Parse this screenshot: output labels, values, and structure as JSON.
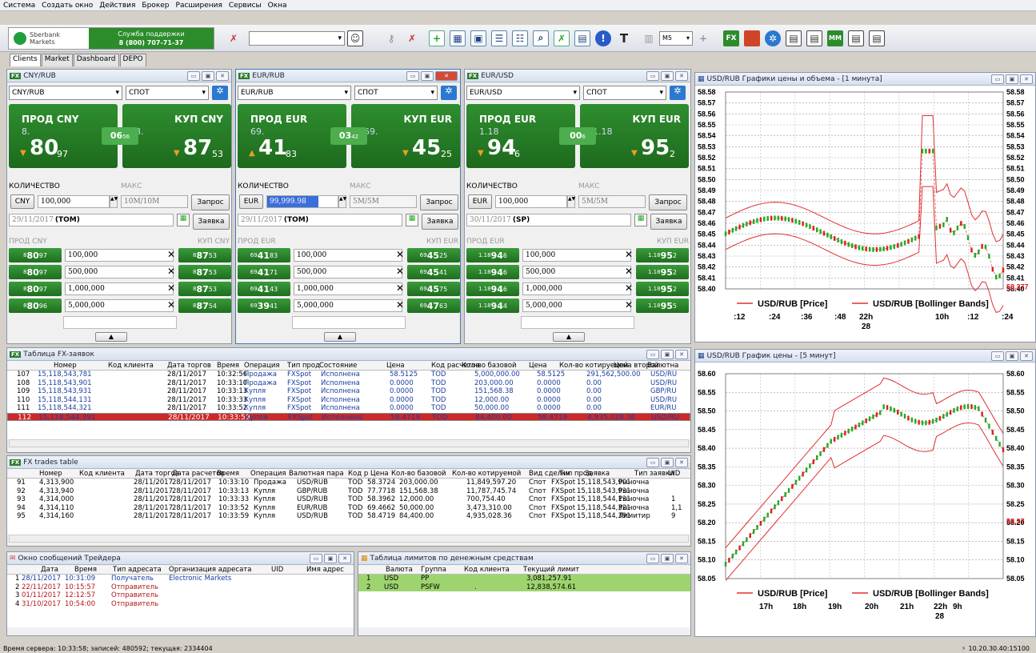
{
  "menu": [
    "Система",
    "Создать окно",
    "Действия",
    "Брокер",
    "Расширения",
    "Сервисы",
    "Окна"
  ],
  "brand": {
    "name": "Sberbank",
    "sub": "Markets",
    "support_title": "Служба поддержки",
    "support_phone": "8 (800) 707-71-37"
  },
  "toolbar": {
    "interval": "M5",
    "fx": "FX",
    "mm": "MM"
  },
  "tabs": [
    "Clients",
    "Market",
    "Dashboard",
    "DEPO"
  ],
  "fx_panels": [
    {
      "title": "CNY/RUB",
      "pair": "CNY/RUB",
      "mode": "СПОТ",
      "sell_label": "ПРОД CNY",
      "buy_label": "КУП CNY",
      "sell_pre": "8.",
      "sell_big": "80",
      "sell_sm": "97",
      "buy_pre": "8.",
      "buy_big": "87",
      "buy_sm": "53",
      "spread_big": "06",
      "spread_sm": "56",
      "qty_label": "КОЛИЧЕСТВО",
      "max_label": "МАКС",
      "ccy": "CNY",
      "qty": "100,000",
      "limit": "10M/10M",
      "request": "Запрос",
      "date": "29/11/2017",
      "date_tag": "(TOM)",
      "order": "Заявка",
      "sell_col": "ПРОД CNY",
      "buy_col": "КУП CNY",
      "ladder": [
        {
          "s_pre": "8",
          "s_big": "80",
          "s_sm": "97",
          "amt": "100,000",
          "b_pre": "8",
          "b_big": "87",
          "b_sm": "53"
        },
        {
          "s_pre": "8",
          "s_big": "80",
          "s_sm": "97",
          "amt": "500,000",
          "b_pre": "8",
          "b_big": "87",
          "b_sm": "53"
        },
        {
          "s_pre": "8",
          "s_big": "80",
          "s_sm": "97",
          "amt": "1,000,000",
          "b_pre": "8",
          "b_big": "87",
          "b_sm": "53"
        },
        {
          "s_pre": "8",
          "s_big": "80",
          "s_sm": "96",
          "amt": "5,000,000",
          "b_pre": "8",
          "b_big": "87",
          "b_sm": "54"
        }
      ]
    },
    {
      "title": "EUR/RUB",
      "pair": "EUR/RUB",
      "mode": "СПОТ",
      "sell_label": "ПРОД EUR",
      "buy_label": "КУП EUR",
      "sell_pre": "69.",
      "sell_big": "41",
      "sell_sm": "83",
      "buy_pre": "69.",
      "buy_big": "45",
      "buy_sm": "25",
      "spread_big": "03",
      "spread_sm": "42",
      "qty_label": "КОЛИЧЕСТВО",
      "max_label": "МАКС",
      "ccy": "EUR",
      "qty": "99,999.98",
      "limit": "5M/5M",
      "request": "Запрос",
      "date": "29/11/2017",
      "date_tag": "(TOM)",
      "order": "Заявка",
      "sell_col": "ПРОД EUR",
      "buy_col": "КУП EUR",
      "ladder": [
        {
          "s_pre": "69",
          "s_big": "41",
          "s_sm": "83",
          "amt": "100,000",
          "b_pre": "69",
          "b_big": "45",
          "b_sm": "25"
        },
        {
          "s_pre": "69",
          "s_big": "41",
          "s_sm": "71",
          "amt": "500,000",
          "b_pre": "69",
          "b_big": "45",
          "b_sm": "41"
        },
        {
          "s_pre": "69",
          "s_big": "41",
          "s_sm": "43",
          "amt": "1,000,000",
          "b_pre": "69",
          "b_big": "45",
          "b_sm": "75"
        },
        {
          "s_pre": "69",
          "s_big": "39",
          "s_sm": "41",
          "amt": "5,000,000",
          "b_pre": "69",
          "b_big": "47",
          "b_sm": "63"
        }
      ]
    },
    {
      "title": "EUR/USD",
      "pair": "EUR/USD",
      "mode": "СПОТ",
      "sell_label": "ПРОД EUR",
      "buy_label": "КУП EUR",
      "sell_pre": "1.18",
      "sell_big": "94",
      "sell_sm": "6",
      "buy_pre": "1.18",
      "buy_big": "95",
      "buy_sm": "2",
      "spread_big": "00",
      "spread_sm": "6",
      "qty_label": "КОЛИЧЕСТВО",
      "max_label": "МАКС",
      "ccy": "EUR",
      "qty": "100,000",
      "limit": "5M/5M",
      "request": "Запрос",
      "date": "30/11/2017",
      "date_tag": "(SP)",
      "order": "Заявка",
      "sell_col": "ПРОД EUR",
      "buy_col": "КУП EUR",
      "ladder": [
        {
          "s_pre": "1.18",
          "s_big": "94",
          "s_sm": "6",
          "amt": "100,000",
          "b_pre": "1.18",
          "b_big": "95",
          "b_sm": "2"
        },
        {
          "s_pre": "1.18",
          "s_big": "94",
          "s_sm": "6",
          "amt": "500,000",
          "b_pre": "1.18",
          "b_big": "95",
          "b_sm": "2"
        },
        {
          "s_pre": "1.18",
          "s_big": "94",
          "s_sm": "6",
          "amt": "1,000,000",
          "b_pre": "1.18",
          "b_big": "95",
          "b_sm": "2"
        },
        {
          "s_pre": "1.18",
          "s_big": "94",
          "s_sm": "4",
          "amt": "5,000,000",
          "b_pre": "1.18",
          "b_big": "95",
          "b_sm": "5"
        }
      ]
    }
  ],
  "orders": {
    "title": "Таблица FX-заявок",
    "cols": [
      "Номер",
      "Код клиента",
      "Дата торгов",
      "Время",
      "Операция",
      "Тип прод",
      "Состояние",
      "Цена",
      "Код расчетов",
      "Кол-во базовой",
      "Цена",
      "Кол-во котируемой",
      "Цена второй",
      "Валютна"
    ],
    "rows": [
      [
        "107",
        "15,118,543,781",
        "28/11/2017",
        "10:32:56",
        "Продажа",
        "FXSpot",
        "Исполнена",
        "58.5125",
        "TOD",
        "5,000,000.00",
        "58.5125",
        "291,562,500.00",
        "",
        "USD/RU"
      ],
      [
        "108",
        "15,118,543,901",
        "28/11/2017",
        "10:33:10",
        "Продажа",
        "FXSpot",
        "Исполнена",
        "0.0000",
        "TOD",
        "203,000.00",
        "0.0000",
        "0.00",
        "",
        "USD/RU"
      ],
      [
        "109",
        "15,118,543,931",
        "28/11/2017",
        "10:33:13",
        "Купля",
        "FXSpot",
        "Исполнена",
        "0.0000",
        "TOD",
        "151,568.38",
        "0.0000",
        "0.00",
        "",
        "GBP/RU"
      ],
      [
        "110",
        "15,118,544,131",
        "28/11/2017",
        "10:33:33",
        "Купля",
        "FXSpot",
        "Исполнена",
        "0.0000",
        "TOD",
        "12,000.00",
        "0.0000",
        "0.00",
        "",
        "USD/RU"
      ],
      [
        "111",
        "15,118,544,321",
        "28/11/2017",
        "10:33:52",
        "Купля",
        "FXSpot",
        "Исполнена",
        "0.0000",
        "TOD",
        "50,000.00",
        "0.0000",
        "0.00",
        "",
        "EUR/RU"
      ],
      [
        "112",
        "15,118,544,391",
        "28/11/2017",
        "10:33:59",
        "Купля",
        "FXSpot",
        "Исполнена",
        "58.4719",
        "TOD",
        "84,400.00",
        "58.4719",
        "4,935,028.36",
        "",
        "USD/RU"
      ]
    ]
  },
  "trades": {
    "title": "FX trades table",
    "cols": [
      "Номер",
      "Код клиента",
      "Дата торгов",
      "Дата расчетов",
      "Время",
      "Операция",
      "Валютная пара",
      "Код р",
      "Цена",
      "Кол-во базовой",
      "Кол-во котируемой",
      "Вид сделки",
      "Тип прод",
      "Заявка",
      "Тип заявки",
      "UID"
    ],
    "rows": [
      [
        "91",
        "4,313,900",
        "",
        "28/11/2017",
        "28/11/2017",
        "10:33:10",
        "Продажа",
        "USD/RUB",
        "TOD",
        "58.3724",
        "203,000.00",
        "11,849,597.20",
        "Спот",
        "FXSpot",
        "15,118,543,901",
        "Рыночна",
        ""
      ],
      [
        "92",
        "4,313,940",
        "",
        "28/11/2017",
        "28/11/2017",
        "10:33:13",
        "Купля",
        "GBP/RUB",
        "TOD",
        "77.7718",
        "151,568.38",
        "11,787,745.74",
        "Спот",
        "FXSpot",
        "15,118,543,931",
        "Рыночна",
        ""
      ],
      [
        "93",
        "4,314,000",
        "",
        "28/11/2017",
        "28/11/2017",
        "10:33:33",
        "Купля",
        "USD/RUB",
        "TOD",
        "58.3962",
        "12,000.00",
        "700,754.40",
        "Спот",
        "FXSpot",
        "15,118,544,131",
        "Рыночна",
        "1"
      ],
      [
        "94",
        "4,314,110",
        "",
        "28/11/2017",
        "28/11/2017",
        "10:33:52",
        "Купля",
        "EUR/RUB",
        "TOD",
        "69.4662",
        "50,000.00",
        "3,473,310.00",
        "Спот",
        "FXSpot",
        "15,118,544,321",
        "Рыночна",
        "1,1"
      ],
      [
        "95",
        "4,314,160",
        "",
        "28/11/2017",
        "28/11/2017",
        "10:33:59",
        "Купля",
        "USD/RUB",
        "TOD",
        "58.4719",
        "84,400.00",
        "4,935,028.36",
        "Спот",
        "FXSpot",
        "15,118,544,391",
        "Лимитир",
        "9"
      ]
    ]
  },
  "messages": {
    "title": "Окно сообщений Трейдера",
    "cols": [
      "Дата",
      "Время",
      "Тип адресата",
      "Организация адресата",
      "UID",
      "Имя адрес"
    ],
    "rows": [
      [
        "1",
        "28/11/2017",
        "10:31:09",
        "Получатель",
        "Electronic Markets"
      ],
      [
        "2",
        "22/11/2017",
        "10:15:57",
        "Отправитель",
        ""
      ],
      [
        "3",
        "01/11/2017",
        "12:12:57",
        "Отправитель",
        ""
      ],
      [
        "4",
        "31/10/2017",
        "10:54:00",
        "Отправитель",
        ""
      ]
    ]
  },
  "limits": {
    "title": "Таблица лимитов по денежным средствам",
    "cols": [
      "Валюта",
      "Группа",
      "Код клиента",
      "Текущий лимит"
    ],
    "rows": [
      [
        "1",
        "USD",
        "PP",
        "",
        "3,081,257.91"
      ],
      [
        "2",
        "USD",
        "PSFW",
        ".",
        "12,838,574.61"
      ]
    ]
  },
  "chart1": {
    "title": "USD/RUB Графики цены и объема - [1 минута]",
    "legend_price": "USD/RUB [Price]",
    "legend_bb": "USD/RUB [Bollinger Bands]",
    "yticks": [
      "58.58",
      "58.57",
      "58.56",
      "58.55",
      "58.54",
      "58.53",
      "58.52",
      "58.51",
      "58.50",
      "58.49",
      "58.48",
      "58.47",
      "58.46",
      "58.45",
      "58.44",
      "58.43",
      "58.42",
      "58.41",
      "58.40"
    ],
    "last": "58.377",
    "xticks": [
      ":12",
      ":24",
      ":36",
      ":48",
      "22h",
      "10h",
      ":12",
      ":24"
    ],
    "xsub": "28"
  },
  "chart2": {
    "title": "USD/RUB График цены - [5 минут]",
    "legend_price": "USD/RUB [Price]",
    "legend_bb": "USD/RUB [Bollinger Bands]",
    "yticks": [
      "58.60",
      "58.55",
      "58.50",
      "58.45",
      "58.40",
      "58.35",
      "58.30",
      "58.25",
      "58.20",
      "58.15",
      "58.10",
      "58.05"
    ],
    "last": "58.37",
    "xticks": [
      "17h",
      "18h",
      "19h",
      "20h",
      "21h",
      "22h",
      "9h"
    ],
    "xsub": "28"
  },
  "chart_data": [
    {
      "type": "line",
      "title": "USD/RUB Графики цены и объема - [1 минута]",
      "series": [
        {
          "name": "USD/RUB [Price]"
        },
        {
          "name": "USD/RUB [Bollinger Bands]"
        }
      ],
      "ylim": [
        58.4,
        58.58
      ]
    },
    {
      "type": "line",
      "title": "USD/RUB График цены - [5 минут]",
      "series": [
        {
          "name": "USD/RUB [Price]"
        },
        {
          "name": "USD/RUB [Bollinger Bands]"
        }
      ],
      "ylim": [
        58.05,
        58.6
      ]
    }
  ],
  "status": {
    "left": "Время сервера: 10:33:58; записей: 480592; текущая: 2334404",
    "right": "10.20.30.40:15100"
  }
}
